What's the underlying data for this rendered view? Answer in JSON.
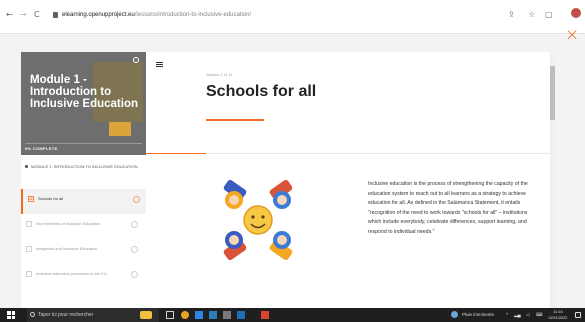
{
  "browser": {
    "back": "←",
    "forward": "→",
    "reload": "C",
    "url_host": "elearning.openupproject.eu",
    "url_path": "/lessons/introduction-to-inclusive-education/"
  },
  "close_glyph": "×",
  "sidebar": {
    "module_title": "Module 1 - Introduction to Inclusive Education",
    "progress_label": "0% COMPLETE",
    "section_heading": "MODULE 1: INTRODUCTION TO INCLUSIVE EDUCATION",
    "lessons": [
      {
        "label": "Schools for all",
        "active": true
      },
      {
        "label": "Key elements of Inclusive Education",
        "active": false
      },
      {
        "label": "Integrated and Inclusive Education",
        "active": false
      },
      {
        "label": "Inclusive education panorama in the EU",
        "active": false
      }
    ]
  },
  "content": {
    "section_count": "Section 1 of 11",
    "title": "Schools for all",
    "body": "Inclusive education is the process of strengthening the capacity of the education system to reach out to all learners as a strategy to achieve education for all. As defined in the Salamanca Statement, it entails \"recognition of the need to work towards \"schools for all\" – institutions which include everybody, celebrate differences, support learning, and respond to individual needs.\""
  },
  "taskbar": {
    "search_placeholder": "Taper ici pour rechercher",
    "weather": "Pluie imminente",
    "time": "11:16",
    "date": "02/11/2022"
  },
  "colors": {
    "accent": "#f26b21"
  }
}
